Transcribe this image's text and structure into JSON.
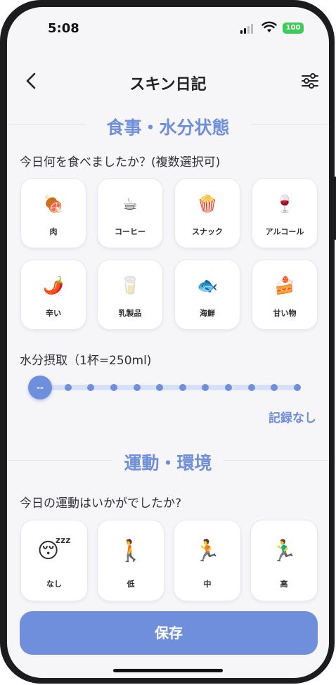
{
  "status": {
    "time": "5:08",
    "battery": "100"
  },
  "nav": {
    "title": "スキン日記"
  },
  "diet": {
    "section_title": "食事・水分状態",
    "question": "今日何を食べましたか？(複数選択可)",
    "items": [
      {
        "icon": "🍖",
        "label": "肉"
      },
      {
        "icon": "☕",
        "label": "コーヒー"
      },
      {
        "icon": "🍿",
        "label": "スナック"
      },
      {
        "icon": "🍷",
        "label": "アルコール"
      },
      {
        "icon": "🌶️",
        "label": "辛い"
      },
      {
        "icon": "🥛",
        "label": "乳製品"
      },
      {
        "icon": "🐟",
        "label": "海鮮"
      },
      {
        "icon": "🍰",
        "label": "甘い物"
      }
    ],
    "hydration_label": "水分摂取（1杯=250ml)",
    "slider_value": "--",
    "hydration_level": 0,
    "hydration_steps": 12,
    "record_status": "記録なし"
  },
  "exercise": {
    "section_title": "運動・環境",
    "question": "今日の運動はいかがでしたか?",
    "options": [
      {
        "icon": "😴",
        "label": "なし"
      },
      {
        "icon": "🚶",
        "label": "低"
      },
      {
        "icon": "🏃",
        "label": "中"
      },
      {
        "icon": "🏃‍♂️",
        "label": "高"
      }
    ]
  },
  "footer": {
    "save_label": "保存"
  },
  "colors": {
    "accent": "#6f8fdc",
    "battery": "#3ecb5a"
  }
}
